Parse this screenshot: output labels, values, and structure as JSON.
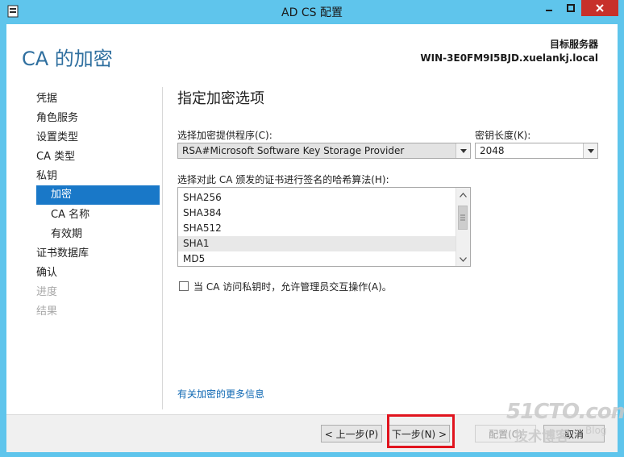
{
  "window": {
    "title": "AD CS 配置"
  },
  "header": {
    "page_title": "CA 的加密",
    "target_label": "目标服务器",
    "target_name": "WIN-3E0FM9I5BJD.xuelankj.local"
  },
  "nav": {
    "items": [
      {
        "label": "凭据",
        "state": "normal"
      },
      {
        "label": "角色服务",
        "state": "normal"
      },
      {
        "label": "设置类型",
        "state": "normal"
      },
      {
        "label": "CA 类型",
        "state": "normal"
      },
      {
        "label": "私钥",
        "state": "normal"
      },
      {
        "label": "加密",
        "state": "selected"
      },
      {
        "label": "CA 名称",
        "state": "normal"
      },
      {
        "label": "有效期",
        "state": "normal"
      },
      {
        "label": "证书数据库",
        "state": "normal"
      },
      {
        "label": "确认",
        "state": "normal"
      },
      {
        "label": "进度",
        "state": "disabled"
      },
      {
        "label": "结果",
        "state": "disabled"
      }
    ]
  },
  "main": {
    "section_title": "指定加密选项",
    "provider_label": "选择加密提供程序(C):",
    "provider_value": "RSA#Microsoft Software Key Storage Provider",
    "key_length_label": "密钥长度(K):",
    "key_length_value": "2048",
    "hash_label": "选择对此 CA 颁发的证书进行签名的哈希算法(H):",
    "hash_items": [
      "SHA256",
      "SHA384",
      "SHA512",
      "SHA1",
      "MD5"
    ],
    "hash_selected": "SHA1",
    "admin_interaction_label": "当 CA 访问私钥时，允许管理员交互操作(A)。",
    "more_info_link": "有关加密的更多信息"
  },
  "footer": {
    "prev_label": "< 上一步(P)",
    "next_label": "下一步(N) >",
    "configure_label": "配置(C)",
    "cancel_label": "取消"
  },
  "watermark": {
    "line1": "51CTO.com",
    "line2": "技术博客",
    "line3": "Blog"
  },
  "colors": {
    "window_frame": "#5fc5ec",
    "accent": "#1978c8",
    "title_text": "#2f6f9f",
    "highlight_box": "#e1141e",
    "close_button": "#c7302a"
  }
}
